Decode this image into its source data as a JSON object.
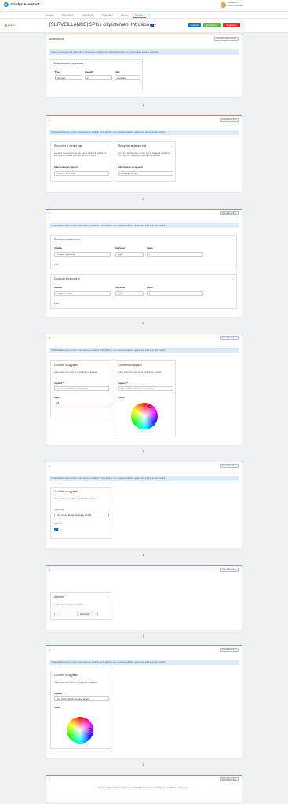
{
  "app": {
    "name": "Gladys Assistant",
    "user_name": "Gu2karo",
    "user_sub": "Administrateur"
  },
  "tabs": [
    "Accueil",
    "Discussion",
    "Intégrations",
    "Calendrier",
    "Pièces",
    "Scènes"
  ],
  "header": {
    "back": "Retour",
    "title": "[SURVEILLANCE] SPG1 clignotement Intrusion",
    "btn_execute": "Exécuter",
    "btn_save": "Enregistrer",
    "btn_delete": "Supprimer"
  },
  "trigger": {
    "title": "Déclencheurs",
    "add_button": "Nouveau déclencheur",
    "info": "Chaque déclencheur est indépendant. Lorsque les conditions de l'un des déclencheurs sont respectées, la scène s'exécute.",
    "card_title": "Déclenchement programmé",
    "labels": [
      "Type",
      "Intervalle",
      "Unité"
    ],
    "values": [
      "Intervalle",
      "3",
      "secondes"
    ]
  },
  "common": {
    "info": "Toutes les actions de ce bloc s'exécuteront en parallèle. Pour effectuer une séquence d'actions, ajoutez des actions au bloc suivant.",
    "add_action": "Nouvelle action"
  },
  "block1": {
    "title": "1.",
    "cards": [
      {
        "title": "Récupérer le dernier état",
        "text": "La scène récupérera le dernier état de l'appareil sélectionné, vous pourrez l'utiliser plus tard dans cette scène.",
        "label": "Sélectionnez un appareil",
        "value": "Intrusion - État (1/3)"
      },
      {
        "title": "Récupérer le dernier état",
        "text": "La scène récupérera le dernier état de l'appareil sélectionné, vous pourrez l'utiliser plus tard dans cette scène.",
        "label": "Sélectionnez un appareil",
        "value": "SURVEILLANCE"
      }
    ]
  },
  "block2": {
    "title": "2.",
    "cards": [
      {
        "title": "Continuer seulement si",
        "var_label": "Variable",
        "var_value": "Intrusion - État (1/3)",
        "op_label": "Opérateur",
        "op_value": "égal",
        "val_label": "Valeur",
        "val_value": "1",
        "add": "+ ou"
      },
      {
        "title": "Continuer seulement si",
        "var_label": "Variable",
        "var_value": "SURVEILLANCE",
        "op_label": "Opérateur",
        "op_value": "égal",
        "val_label": "Valeur",
        "val_value": "1",
        "add": "+ ou"
      }
    ]
  },
  "block3": {
    "title": "3.",
    "cards": [
      {
        "title": "Contrôler un appareil",
        "text": "Cette action vous permet de contrôler un appareil.",
        "label": "Appareil *",
        "value": "Spot Couloir Entrée (Luminosité tot",
        "val_label": "Valeur",
        "val_value": "254"
      },
      {
        "title": "Contrôler un appareil",
        "text": "Cette action vous permet de contrôler un appareil.",
        "label": "Appareil *",
        "value": "Spot Couloir Entrée (Couleur éclaira",
        "val_label": "Valeur"
      }
    ]
  },
  "block4": {
    "title": "4.",
    "card": {
      "title": "Contrôler un appareil",
      "text": "Cette action vous permet de contrôler un appareil.",
      "label": "Appareil *",
      "value": "Spot Couloir Entrée (Éclairage On/Off)",
      "val_label": "Valeur *"
    }
  },
  "block5": {
    "title": "5.",
    "card": {
      "title": "Attendre",
      "text": "La Box attendra la durée spécifiée",
      "value": "2",
      "unit": "secondes"
    }
  },
  "block6": {
    "title": "6.",
    "card": {
      "title": "Contrôler un appareil",
      "text": "Cette action vous permet de contrôler un appareil.",
      "label": "Appareil *",
      "value": "Spot Couloir Entrée (Couleur éclaira",
      "val_label": "Valeur *"
    }
  },
  "block7": {
    "title": "7.",
    "footer": "Aucune action n'a encore été ajoutée. Cliquez sur le bouton ci-joint ajouter une action à cette scène."
  },
  "colors": {
    "accent": "#1fa0d8",
    "panel_border": "#6dbf43",
    "execute": "#1f6fb0",
    "save": "#5fb840",
    "delete": "#d83030",
    "info_bg": "#dcebf7"
  }
}
